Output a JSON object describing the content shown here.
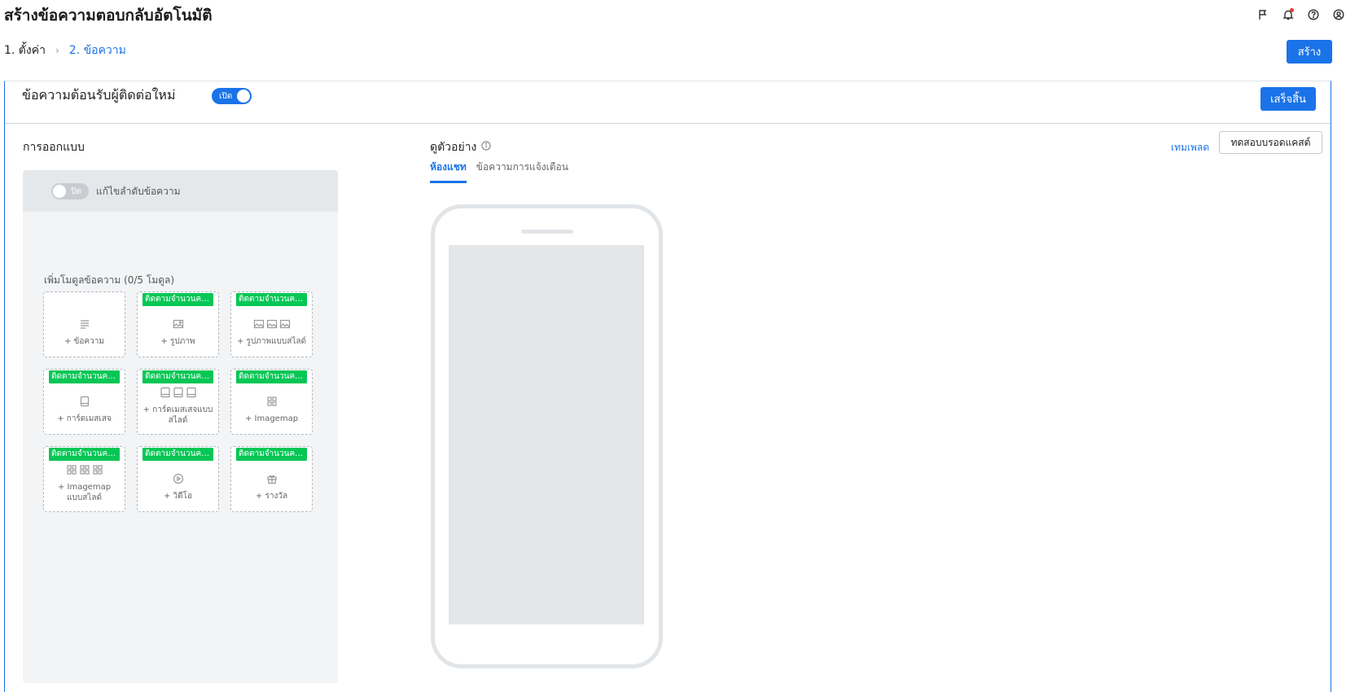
{
  "page": {
    "title": "สร้างข้อความตอบกลับอัตโนมัติ"
  },
  "top_icons": [
    "flag-icon",
    "bell-icon",
    "help-icon",
    "account-icon"
  ],
  "steps": {
    "step1": "1. ตั้งค่า",
    "separator": "›",
    "step2": "2. ข้อความ"
  },
  "buttons": {
    "create": "สร้าง",
    "done": "เสร็จสิ้น",
    "test_broadcast": "ทดสอบบรอดแคสต์"
  },
  "card": {
    "title": "ข้อความต้อนรับผู้ติดต่อใหม่",
    "toggle_label": "เปิด"
  },
  "design": {
    "heading": "การออกแบบ",
    "reorder_toggle": "ปิด",
    "reorder_label": "แก้ไขลำดับข้อความ",
    "add_modules": "เพิ่มโมดูลข้อความ (0/5 โมดูล)",
    "modules": [
      {
        "label": "+ ข้อความ",
        "badge": "",
        "icon": "text-icon"
      },
      {
        "label": "+ รูปภาพ",
        "badge": "ติดตามจำนวนคน...",
        "icon": "image-icon"
      },
      {
        "label": "+ รูปภาพแบบสไลด์",
        "badge": "ติดตามจำนวนคน...",
        "icon": "image-carousel-icon"
      },
      {
        "label": "+ การ์ดเมสเสจ",
        "badge": "ติดตามจำนวนคน...",
        "icon": "card-icon"
      },
      {
        "label": "+ การ์ดเมสเสจแบบสไลด์",
        "badge": "ติดตามจำนวนคน...",
        "icon": "card-carousel-icon"
      },
      {
        "label": "+ Imagemap",
        "badge": "ติดตามจำนวนคน...",
        "icon": "imagemap-icon"
      },
      {
        "label": "+ Imagemap แบบสไลด์",
        "badge": "ติดตามจำนวนคน...",
        "icon": "imagemap-carousel-icon"
      },
      {
        "label": "+ วิดีโอ",
        "badge": "ติดตามจำนวนคน...",
        "icon": "video-icon"
      },
      {
        "label": "+ รางวัล",
        "badge": "ติดตามจำนวนคน...",
        "icon": "gift-icon"
      }
    ]
  },
  "preview": {
    "heading": "ดูตัวอย่าง",
    "template_link": "เทมเพลต",
    "tabs": [
      {
        "label": "ห้องแชท",
        "active": true
      },
      {
        "label": "ข้อความการแจ้งเตือน",
        "active": false
      }
    ]
  },
  "colors": {
    "accent": "#1a73e8",
    "badge_green": "#06c755",
    "notification_dot": "#e53935"
  }
}
